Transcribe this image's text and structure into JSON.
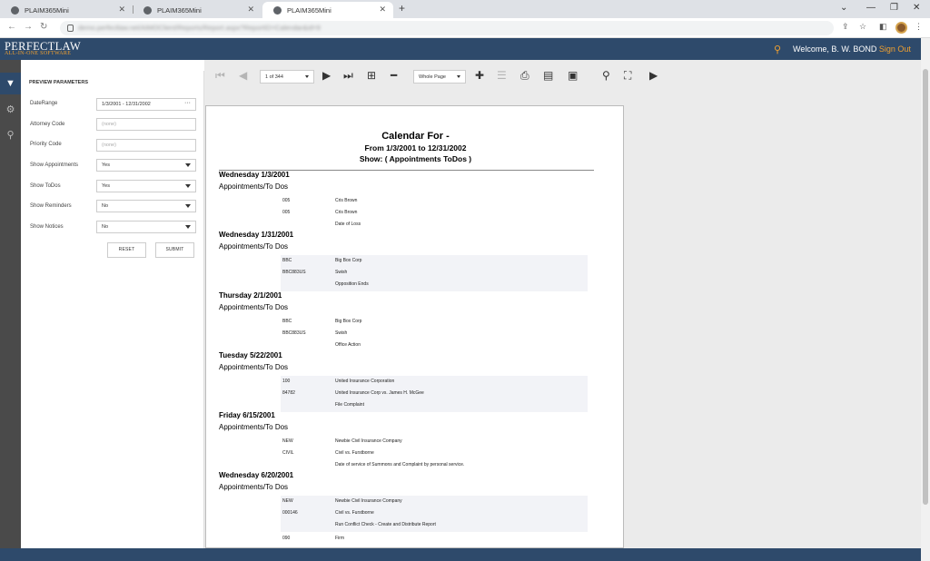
{
  "browser": {
    "tabs": [
      {
        "title": "PLAIM365Mini"
      },
      {
        "title": "PLAIM365Mini"
      },
      {
        "title": "PLAIM365Mini"
      }
    ],
    "url": "demo.perfectlaw.net/AIMOClient/Reports/Report.aspx?ReportID=Calendar&id=9"
  },
  "app": {
    "logo_main": "PERFECTLAW",
    "logo_sub": "ALL-IN-ONE SOFTWARE",
    "welcome": "Welcome, B. W. BOND",
    "signout": "Sign Out"
  },
  "params": {
    "title": "PREVIEW PARAMETERS",
    "rows": [
      {
        "label": "DateRange",
        "value": "1/3/2001 - 12/31/2002",
        "kind": "dots"
      },
      {
        "label": "Attorney Code",
        "value": "(none)",
        "kind": "placeholder"
      },
      {
        "label": "Priority Code",
        "value": "(none)",
        "kind": "placeholder"
      },
      {
        "label": "Show Appointments",
        "value": "Yes",
        "kind": "select"
      },
      {
        "label": "Show ToDos",
        "value": "Yes",
        "kind": "select"
      },
      {
        "label": "Show Reminders",
        "value": "No",
        "kind": "select"
      },
      {
        "label": "Show Notices",
        "value": "No",
        "kind": "select"
      }
    ],
    "reset": "RESET",
    "submit": "SUBMIT"
  },
  "toolbar": {
    "page_of": "1 of 344",
    "zoom": "Whole Page"
  },
  "report": {
    "title": "Calendar For  -",
    "range": "From 1/3/2001 to 12/31/2002",
    "show": "Show: ( Appointments ToDos )",
    "days": [
      {
        "date": "Wednesday 1/3/2001",
        "section": "Appointments/To Dos",
        "shaded": false,
        "rows": [
          [
            "005",
            "Cris Brown"
          ],
          [
            "005",
            "Cris Brown"
          ],
          [
            "",
            "Date of Loss"
          ]
        ]
      },
      {
        "date": "Wednesday 1/31/2001",
        "section": "Appointments/To Dos",
        "shaded": true,
        "rows": [
          [
            "BBC",
            "Big Box Corp"
          ],
          [
            "BBC883US",
            "Swish"
          ],
          [
            "",
            "Opposition Ends"
          ]
        ]
      },
      {
        "date": "Thursday 2/1/2001",
        "section": "Appointments/To Dos",
        "shaded": false,
        "rows": [
          [
            "BBC",
            "Big Box Corp"
          ],
          [
            "BBC883US",
            "Swish"
          ],
          [
            "",
            "Office Action"
          ]
        ]
      },
      {
        "date": "Tuesday 5/22/2001",
        "section": "Appointments/To Dos",
        "shaded": true,
        "rows": [
          [
            "100",
            "United Insurance Corporation"
          ],
          [
            "84782",
            "United Insurance Corp vs. James H. McGee"
          ],
          [
            "",
            "File Complaint"
          ]
        ]
      },
      {
        "date": "Friday 6/15/2001",
        "section": "Appointments/To Dos",
        "shaded": false,
        "rows": [
          [
            "NEW",
            "Newbie Civil Insurance Company"
          ],
          [
            "CIVIL",
            "Civil vs. Furstborne"
          ],
          [
            "",
            "Date of service of Summons and Complaint by personal service."
          ]
        ]
      },
      {
        "date": "Wednesday 6/20/2001",
        "section": "Appointments/To Dos",
        "shaded": true,
        "rows": [
          [
            "NEW",
            "Newbie Civil Insurance Company"
          ],
          [
            "000146",
            "Civil vs. Furstborne"
          ],
          [
            "",
            "Run Conflict Check - Create and Distribute Report"
          ]
        ]
      }
    ],
    "trailing_row": [
      "090",
      "Firm"
    ]
  }
}
